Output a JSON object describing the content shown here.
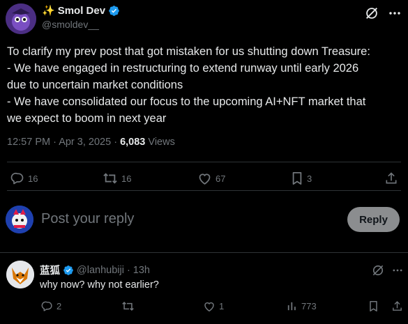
{
  "post": {
    "author_emoji": "✨",
    "author_name": "Smol Dev",
    "handle": "@smoldev__",
    "text_lines": [
      "To clarify my prev post that got mistaken for us shutting down Treasure:",
      "- We have engaged in restructuring to extend runway until early 2026",
      "due to uncertain market conditions",
      "- We have consolidated our focus to the upcoming AI+NFT market that",
      "we expect to boom in next year"
    ],
    "time": "12:57 PM",
    "separator": "·",
    "date": "Apr 3, 2025",
    "views_count": "6,083",
    "views_label": "Views",
    "stats": {
      "replies": "16",
      "reposts": "16",
      "likes": "67",
      "bookmarks": "3"
    }
  },
  "composer": {
    "placeholder": "Post your reply",
    "button_label": "Reply"
  },
  "comment": {
    "name": "蓝狐",
    "handle": "@lanhubiji",
    "separator": "·",
    "time": "13h",
    "text": "why now?  why not earlier?",
    "stats": {
      "replies": "2",
      "reposts": "",
      "likes": "1",
      "views": "773"
    }
  },
  "colors": {
    "background": "#000000",
    "text": "#e7e9ea",
    "muted": "#71767b",
    "divider": "#2f3336",
    "verified": "#1d9bf0",
    "reply_button": "#8b8d8f"
  }
}
